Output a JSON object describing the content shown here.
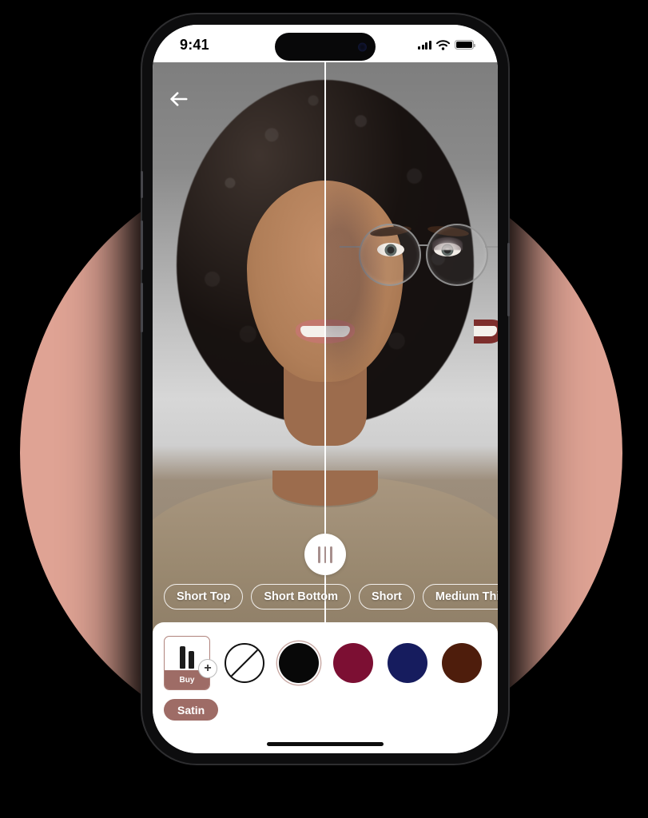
{
  "backdrop": {
    "page_background": "#000000",
    "circle_color": "#dfa394"
  },
  "device": {
    "frame_color": "#0d0d0e",
    "screen_background": "#ffffff"
  },
  "status_bar": {
    "time": "9:41",
    "signal_icon": "cellular-signal-icon",
    "wifi_icon": "wifi-icon",
    "battery_icon": "battery-icon",
    "dynamic_island": "dynamic-island",
    "camera": "front-camera-icon"
  },
  "preview": {
    "back_icon": "back-arrow-icon",
    "split_handle_icon": "split-compare-handle",
    "split_position_percent": 50,
    "mode": "before-after-compare"
  },
  "hairstyles": {
    "items": [
      {
        "label": "Short Top"
      },
      {
        "label": "Short Bottom"
      },
      {
        "label": "Short"
      },
      {
        "label": "Medium Thin"
      }
    ]
  },
  "bottom_sheet": {
    "product_card": {
      "art_icon": "lipstick-wands-icon",
      "buy_label": "Buy",
      "add_icon": "plus-icon"
    },
    "swatches": [
      {
        "name": "no-color",
        "label": "None",
        "color": "#ffffff",
        "selected": false,
        "type": "none"
      },
      {
        "name": "black",
        "label": "Black",
        "color": "#080808",
        "selected": true,
        "type": "color"
      },
      {
        "name": "crimson",
        "label": "Crimson",
        "color": "#7c0f33",
        "selected": false,
        "type": "color"
      },
      {
        "name": "navy",
        "label": "Navy",
        "color": "#161c5e",
        "selected": false,
        "type": "color"
      },
      {
        "name": "dark-brown",
        "label": "Dark Brown",
        "color": "#4e1d0c",
        "selected": false,
        "type": "color"
      }
    ],
    "finish": {
      "label": "Satin",
      "color": "#9e6c66"
    },
    "home_indicator": "home-indicator"
  }
}
